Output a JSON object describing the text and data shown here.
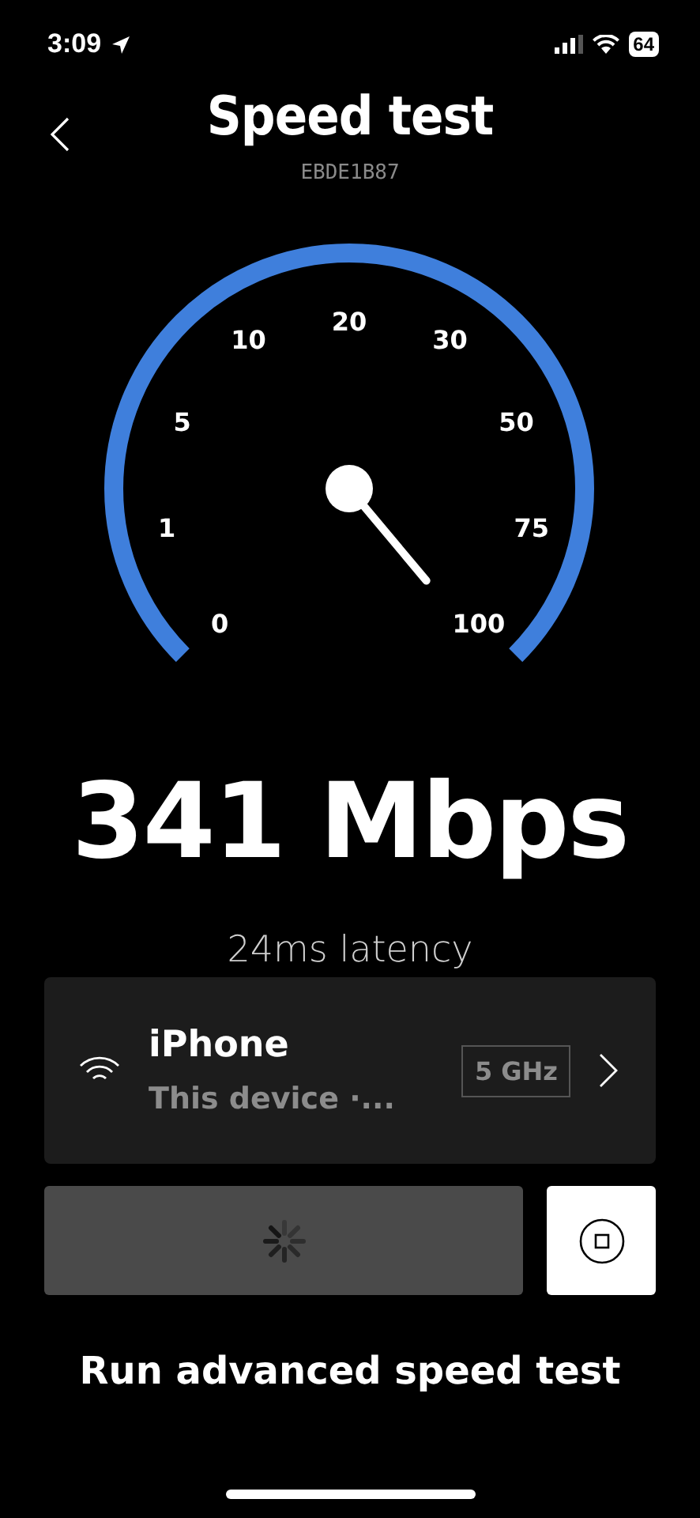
{
  "status_bar": {
    "time": "3:09",
    "battery": "64"
  },
  "header": {
    "title": "Speed test",
    "device_id": "EBDE1B87"
  },
  "gauge": {
    "scale_labels": [
      "0",
      "1",
      "5",
      "10",
      "20",
      "30",
      "50",
      "75",
      "100"
    ]
  },
  "result": {
    "speed": "341 Mbps",
    "latency": "24ms latency"
  },
  "device_card": {
    "name": "iPhone",
    "subtitle": "This device ·...",
    "band": "5 GHz"
  },
  "actions": {
    "running": true
  },
  "advanced_link": "Run advanced speed test"
}
